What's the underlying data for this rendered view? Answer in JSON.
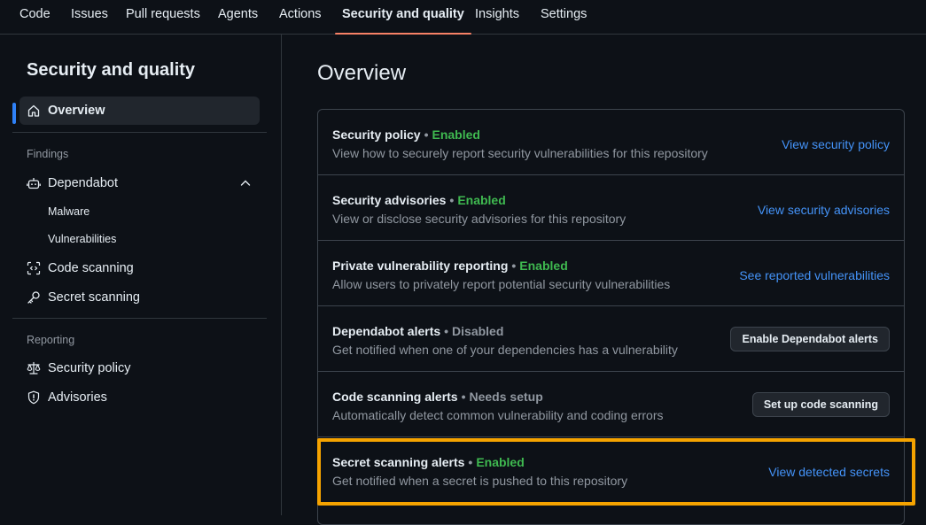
{
  "topnav": {
    "tabs": [
      {
        "label": "Code"
      },
      {
        "label": "Issues"
      },
      {
        "label": "Pull requests"
      },
      {
        "label": "Agents"
      },
      {
        "label": "Actions"
      },
      {
        "label": "Security and quality",
        "active": true
      },
      {
        "label": "Insights"
      },
      {
        "label": "Settings"
      }
    ]
  },
  "sidebar": {
    "title": "Security and quality",
    "overview": "Overview",
    "findings_label": "Findings",
    "dependabot": "Dependabot",
    "malware": "Malware",
    "vulnerabilities": "Vulnerabilities",
    "code_scanning": "Code scanning",
    "secret_scanning": "Secret scanning",
    "reporting_label": "Reporting",
    "security_policy": "Security policy",
    "advisories": "Advisories"
  },
  "main": {
    "title": "Overview",
    "rows": [
      {
        "name": "Security policy",
        "sep": "•",
        "status": "Enabled",
        "desc": "View how to securely report security vulnerabilities for this repository",
        "action": "View security policy"
      },
      {
        "name": "Security advisories",
        "sep": "•",
        "status": "Enabled",
        "desc": "View or disclose security advisories for this repository",
        "action": "View security advisories"
      },
      {
        "name": "Private vulnerability reporting",
        "sep": "•",
        "status": "Enabled",
        "desc": "Allow users to privately report potential security vulnerabilities",
        "action": "See reported vulnerabilities"
      },
      {
        "name": "Dependabot alerts",
        "sep": "•",
        "status": "Disabled",
        "desc": "Get notified when one of your dependencies has a vulnerability",
        "action": "Enable Dependabot alerts"
      },
      {
        "name": "Code scanning alerts",
        "sep": "•",
        "status": "Needs setup",
        "desc": "Automatically detect common vulnerability and coding errors",
        "action": "Set up code scanning"
      },
      {
        "name": "Secret scanning alerts",
        "sep": "•",
        "status": "Enabled",
        "desc": "Get notified when a secret is pushed to this repository",
        "action": "View detected secrets"
      }
    ]
  },
  "colors": {
    "background": "#0d1117",
    "enabled": "#3fb950",
    "muted": "#9198a1",
    "link": "#4493f8",
    "highlight": "#f5a300",
    "active_tab_underline": "#f78166",
    "selected_indicator": "#2f81f7"
  },
  "icons": [
    "home-icon",
    "dependabot-icon",
    "chevron-up-icon",
    "code-scan-icon",
    "key-icon",
    "law-icon",
    "shield-icon"
  ]
}
